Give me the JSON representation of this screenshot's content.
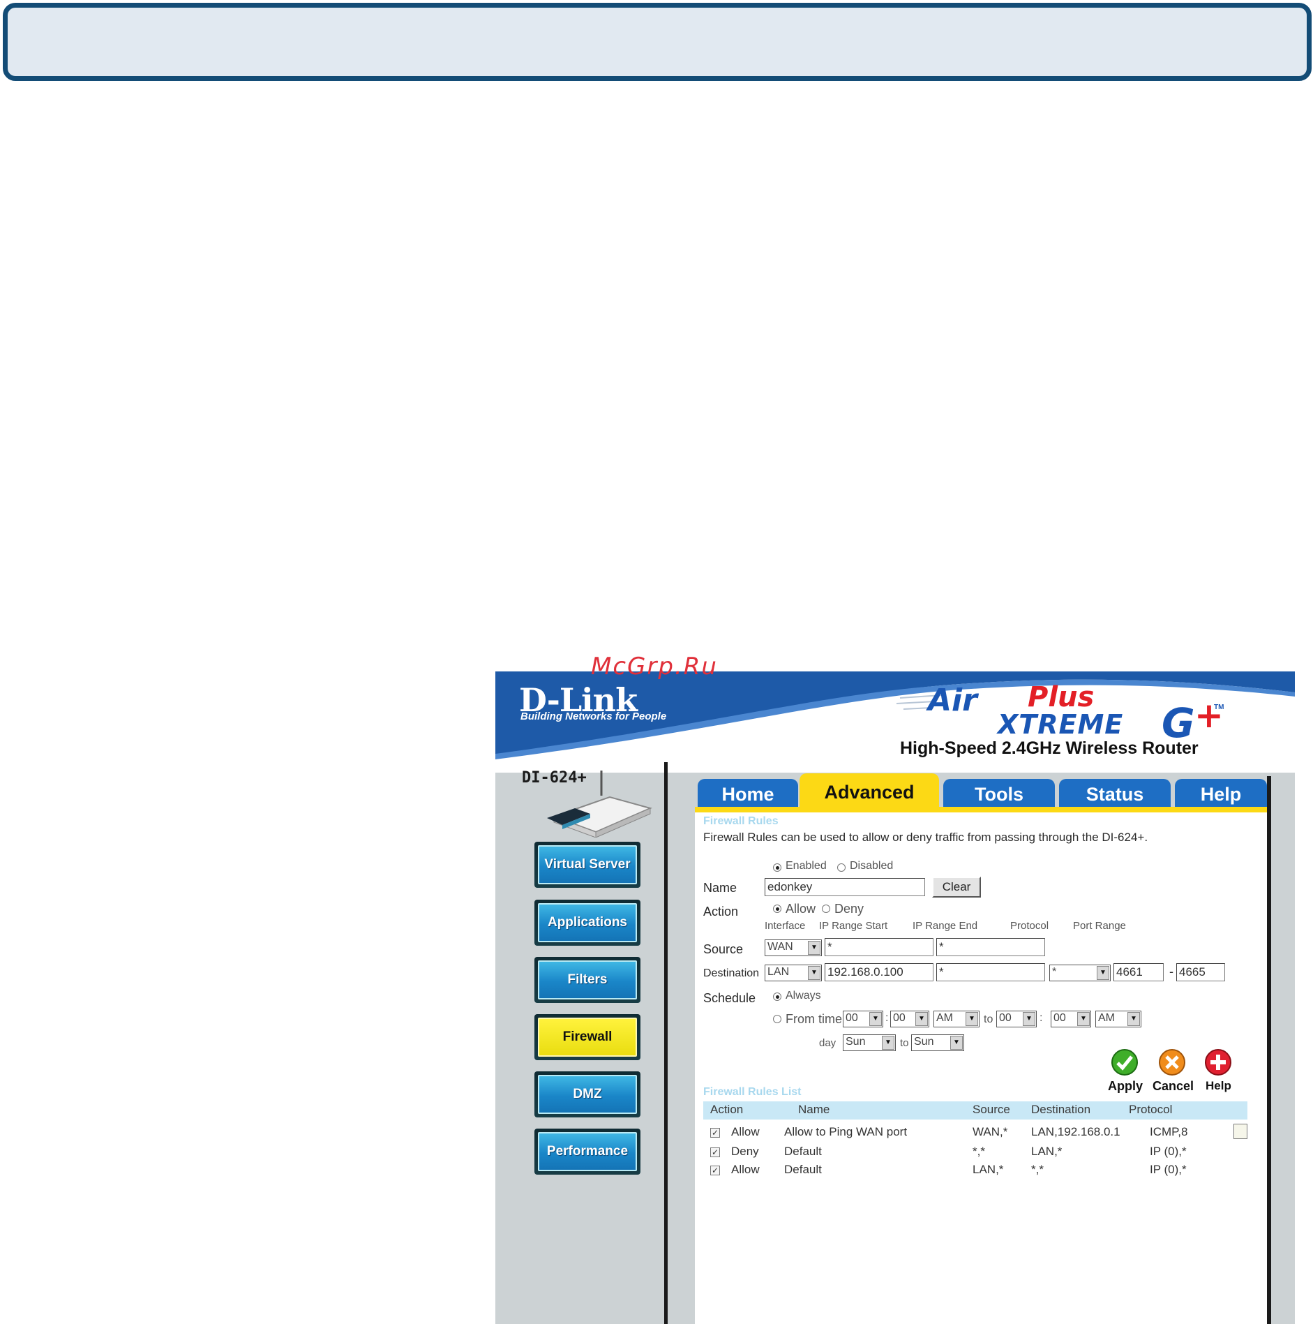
{
  "watermark": "McGrp.Ru",
  "header": {
    "logo": "D-Link",
    "tagline": "Building Networks for People",
    "brand_air": "Air",
    "brand_plus": "Plus",
    "brand_xtreme": "XTREME",
    "brand_g": "G",
    "brand_gplus": "+",
    "brand_tm": "TM",
    "product_line": "High-Speed 2.4GHz Wireless Router"
  },
  "sidebar": {
    "model": "DI-624+",
    "items": [
      {
        "label": "Virtual Server",
        "active": false
      },
      {
        "label": "Applications",
        "active": false
      },
      {
        "label": "Filters",
        "active": false
      },
      {
        "label": "Firewall",
        "active": true
      },
      {
        "label": "DMZ",
        "active": false
      },
      {
        "label": "Performance",
        "active": false
      }
    ]
  },
  "tabs": [
    {
      "label": "Home",
      "active": false
    },
    {
      "label": "Advanced",
      "active": true
    },
    {
      "label": "Tools",
      "active": false
    },
    {
      "label": "Status",
      "active": false
    },
    {
      "label": "Help",
      "active": false
    }
  ],
  "form": {
    "title": "Firewall Rules",
    "description": "Firewall Rules can be used to allow or deny traffic from passing through the DI-624+.",
    "enabled_label": "Enabled",
    "disabled_label": "Disabled",
    "state": "Enabled",
    "name_label": "Name",
    "name_value": "edonkey",
    "clear_label": "Clear",
    "action_label": "Action",
    "allow_label": "Allow",
    "deny_label": "Deny",
    "action_value": "Allow",
    "col_interface": "Interface",
    "col_ip_start": "IP Range Start",
    "col_ip_end": "IP Range End",
    "col_protocol": "Protocol",
    "col_port_range": "Port Range",
    "source_label": "Source",
    "source_interface": "WAN",
    "source_ip_start": "*",
    "source_ip_end": "*",
    "destination_label": "Destination",
    "dest_interface": "LAN",
    "dest_ip_start": "192.168.0.100",
    "dest_ip_end": "*",
    "dest_protocol": "*",
    "dest_port_start": "4661",
    "dest_port_sep": "-",
    "dest_port_end": "4665",
    "schedule_label": "Schedule",
    "always_label": "Always",
    "from_time_label": "From time",
    "schedule_value": "Always",
    "from_hour": "00",
    "from_min": "00",
    "from_ampm": "AM",
    "to_label": "to",
    "to_hour": "00",
    "to_min": "00",
    "to_ampm": "AM",
    "time_sep": ":",
    "day_label": "day",
    "day_from": "Sun",
    "day_to_label": "to",
    "day_to": "Sun"
  },
  "actions": {
    "apply": "Apply",
    "cancel": "Cancel",
    "help": "Help"
  },
  "rules_list": {
    "title": "Firewall Rules List",
    "headers": {
      "action": "Action",
      "name": "Name",
      "source": "Source",
      "destination": "Destination",
      "protocol": "Protocol"
    },
    "rows": [
      {
        "checked": true,
        "action": "Allow",
        "name": "Allow to Ping WAN port",
        "source": "WAN,*",
        "destination": "LAN,192.168.0.1",
        "protocol": "ICMP,8",
        "editable": true
      },
      {
        "checked": true,
        "action": "Deny",
        "name": "Default",
        "source": "*,*",
        "destination": "LAN,*",
        "protocol": "IP (0),*",
        "editable": false
      },
      {
        "checked": true,
        "action": "Allow",
        "name": "Default",
        "source": "LAN,*",
        "destination": "*,*",
        "protocol": "IP (0),*",
        "editable": false
      }
    ]
  },
  "colors": {
    "frame_border": "#134c76",
    "frame_fill": "#e1e9f1",
    "header_blue": "#1e5aa8",
    "tab_blue": "#1e6ec4",
    "tab_active": "#fcd915",
    "side_button": "#1a86c8",
    "side_active": "#fff23c",
    "section_title": "#a8d8ee",
    "table_header": "#c9e8f6",
    "watermark": "#e0303a"
  }
}
